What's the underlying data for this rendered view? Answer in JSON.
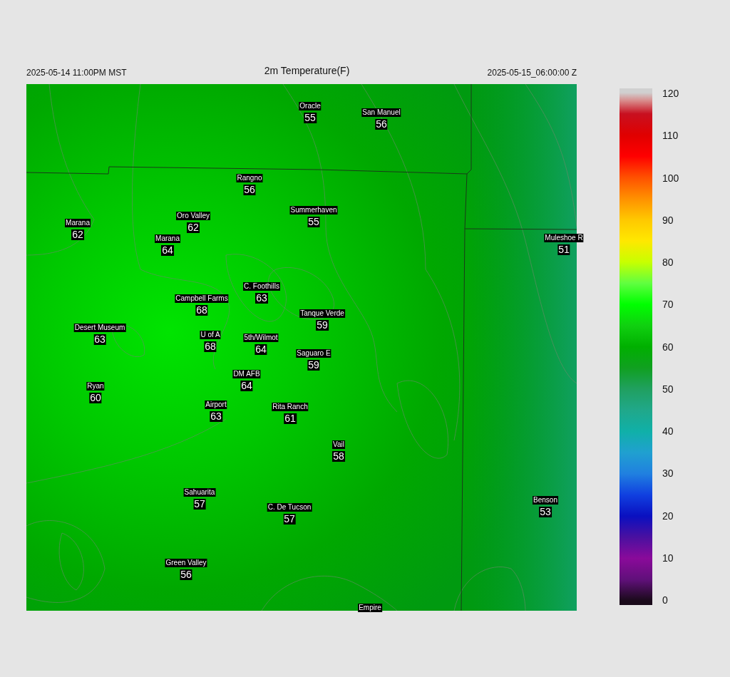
{
  "header": {
    "local_time": "2025-05-14 11:00PM MST",
    "title": "2m Temperature(F)",
    "utc_time": "2025-05-15_06:00:00 Z"
  },
  "stations": [
    {
      "name": "Oracle",
      "value": "55"
    },
    {
      "name": "San Manuel",
      "value": "56"
    },
    {
      "name": "Rangno",
      "value": "56"
    },
    {
      "name": "Marana",
      "value": "62"
    },
    {
      "name": "Oro Valley",
      "value": "62"
    },
    {
      "name": "Marana",
      "value": "64"
    },
    {
      "name": "Summerhaven",
      "value": "55"
    },
    {
      "name": "Muleshoe R",
      "value": "51"
    },
    {
      "name": "C. Foothills",
      "value": "63"
    },
    {
      "name": "Campbell Farms",
      "value": "68"
    },
    {
      "name": "Tanque Verde",
      "value": "59"
    },
    {
      "name": "Desert Museum",
      "value": "63"
    },
    {
      "name": "U of A",
      "value": "68"
    },
    {
      "name": "5th/Wilmot",
      "value": "64"
    },
    {
      "name": "Saguaro E",
      "value": "59"
    },
    {
      "name": "Ryan",
      "value": "60"
    },
    {
      "name": "DM AFB",
      "value": "64"
    },
    {
      "name": "Airport",
      "value": "63"
    },
    {
      "name": "Rita Ranch",
      "value": "61"
    },
    {
      "name": "Vail",
      "value": "58"
    },
    {
      "name": "Sahuarita",
      "value": "57"
    },
    {
      "name": "C. De Tucson",
      "value": "57"
    },
    {
      "name": "Benson",
      "value": "53"
    },
    {
      "name": "Green Valley",
      "value": "56"
    },
    {
      "name": "Empire"
    }
  ],
  "colorbar": {
    "ticks": [
      "120",
      "110",
      "100",
      "90",
      "80",
      "70",
      "60",
      "50",
      "40",
      "30",
      "20",
      "10",
      "0"
    ]
  }
}
